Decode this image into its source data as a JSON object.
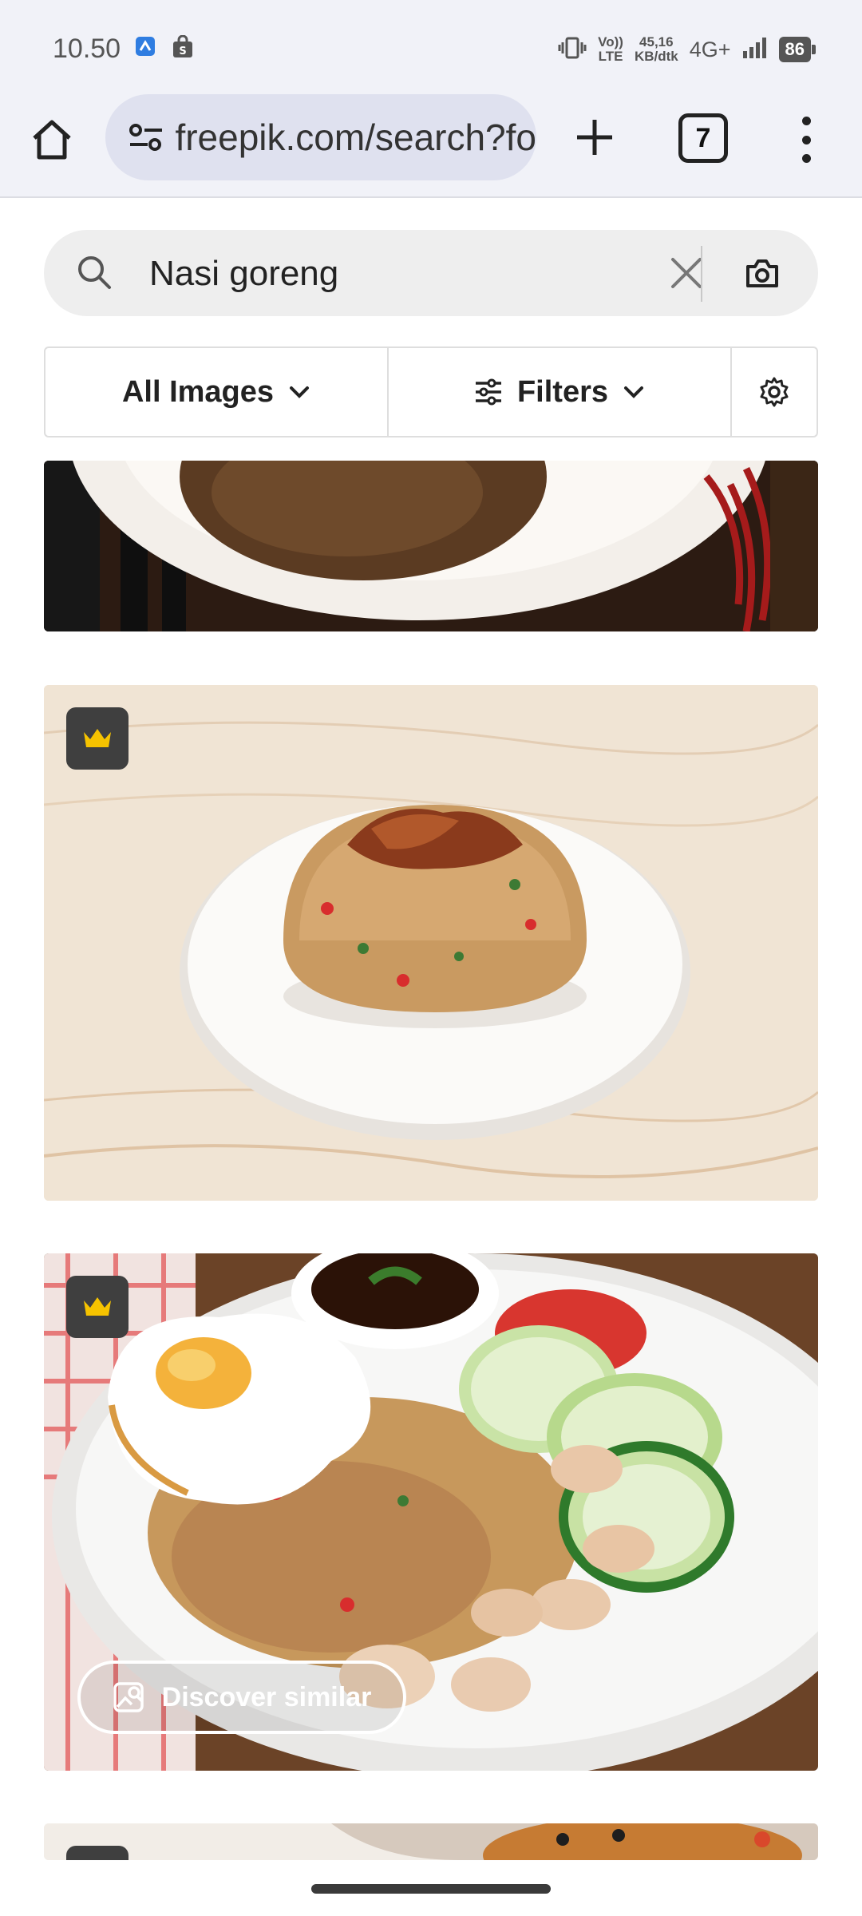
{
  "status_bar": {
    "time": "10.50",
    "net_top": "45,16",
    "net_bottom": "KB/dtk",
    "volte_top": "Vo))",
    "volte_bottom": "LTE",
    "network": "4G+",
    "battery": "86",
    "icons": [
      "app-notification-icon",
      "shopping-bag-icon",
      "vibrate-icon",
      "signal-icon",
      "battery-icon"
    ]
  },
  "browser": {
    "url": "freepik.com/search?fo",
    "tab_count": "7",
    "icons": [
      "home-icon",
      "site-settings-icon",
      "plus-icon",
      "tabs-icon",
      "more-vert-icon"
    ]
  },
  "search": {
    "query": "Nasi goreng",
    "icons": [
      "search-icon",
      "close-icon",
      "camera-icon"
    ]
  },
  "filters": {
    "all_images_label": "All Images",
    "filters_label": "Filters",
    "icons": [
      "chevron-down-icon",
      "sliders-icon",
      "gear-icon"
    ]
  },
  "results": [
    {
      "description_hidden": true,
      "premium": false
    },
    {
      "premium": true
    },
    {
      "premium": true,
      "discover_label": "Discover similar"
    },
    {
      "premium": true
    }
  ],
  "colors": {
    "accent_crown": "#f6c300",
    "badge_bg": "#3f3f3f",
    "chrome_bg": "#f1f2f8"
  }
}
